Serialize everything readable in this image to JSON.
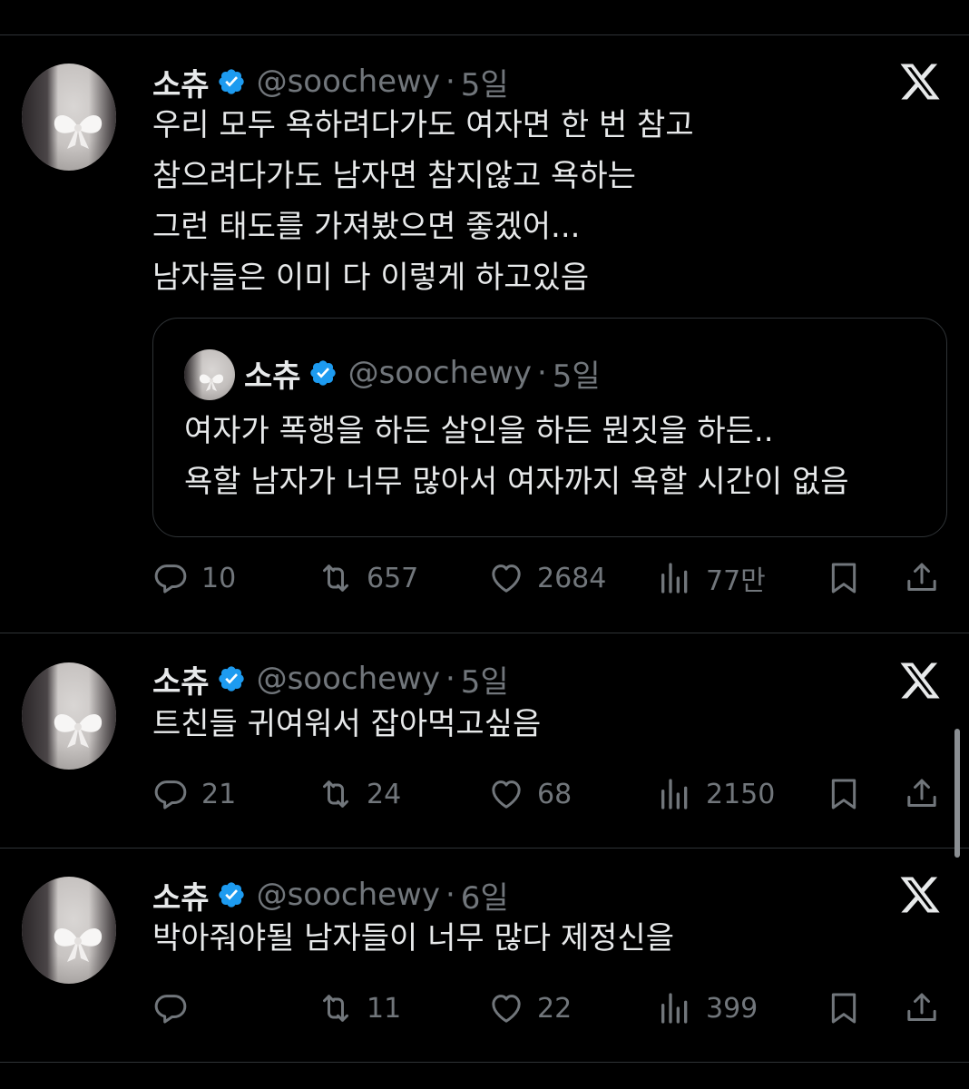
{
  "colors": {
    "background": "#000000",
    "text": "#e7e9ea",
    "muted": "#71767b",
    "divider": "#2f3336",
    "verified": "#1d9bf0"
  },
  "tweets": [
    {
      "name": "소츄",
      "handle": "@soochewy",
      "separator": "·",
      "time": "5일",
      "text": "우리 모두 욕하려다가도 여자면 한 번 참고\n참으려다가도 남자면 참지않고 욕하는\n그런 태도를 가져봤으면 좋겠어...\n남자들은 이미 다 이렇게 하고있음",
      "quote": {
        "name": "소츄",
        "handle": "@soochewy",
        "separator": "·",
        "time": "5일",
        "text": "여자가 폭행을 하든 살인을 하든 뭔짓을 하든..\n욕할 남자가 너무 많아서 여자까지 욕할 시간이 없음"
      },
      "replies": "10",
      "reposts": "657",
      "likes": "2684",
      "views": "77만"
    },
    {
      "name": "소츄",
      "handle": "@soochewy",
      "separator": "·",
      "time": "5일",
      "text": "트친들 귀여워서 잡아먹고싶음",
      "replies": "21",
      "reposts": "24",
      "likes": "68",
      "views": "2150"
    },
    {
      "name": "소츄",
      "handle": "@soochewy",
      "separator": "·",
      "time": "6일",
      "text": "박아줘야될 남자들이 너무 많다 제정신을",
      "replies": "",
      "reposts": "11",
      "likes": "22",
      "views": "399"
    }
  ],
  "icons": [
    "verified-badge-icon",
    "x-logo-icon",
    "reply-icon",
    "repost-icon",
    "like-icon",
    "views-icon",
    "bookmark-icon",
    "share-icon"
  ]
}
